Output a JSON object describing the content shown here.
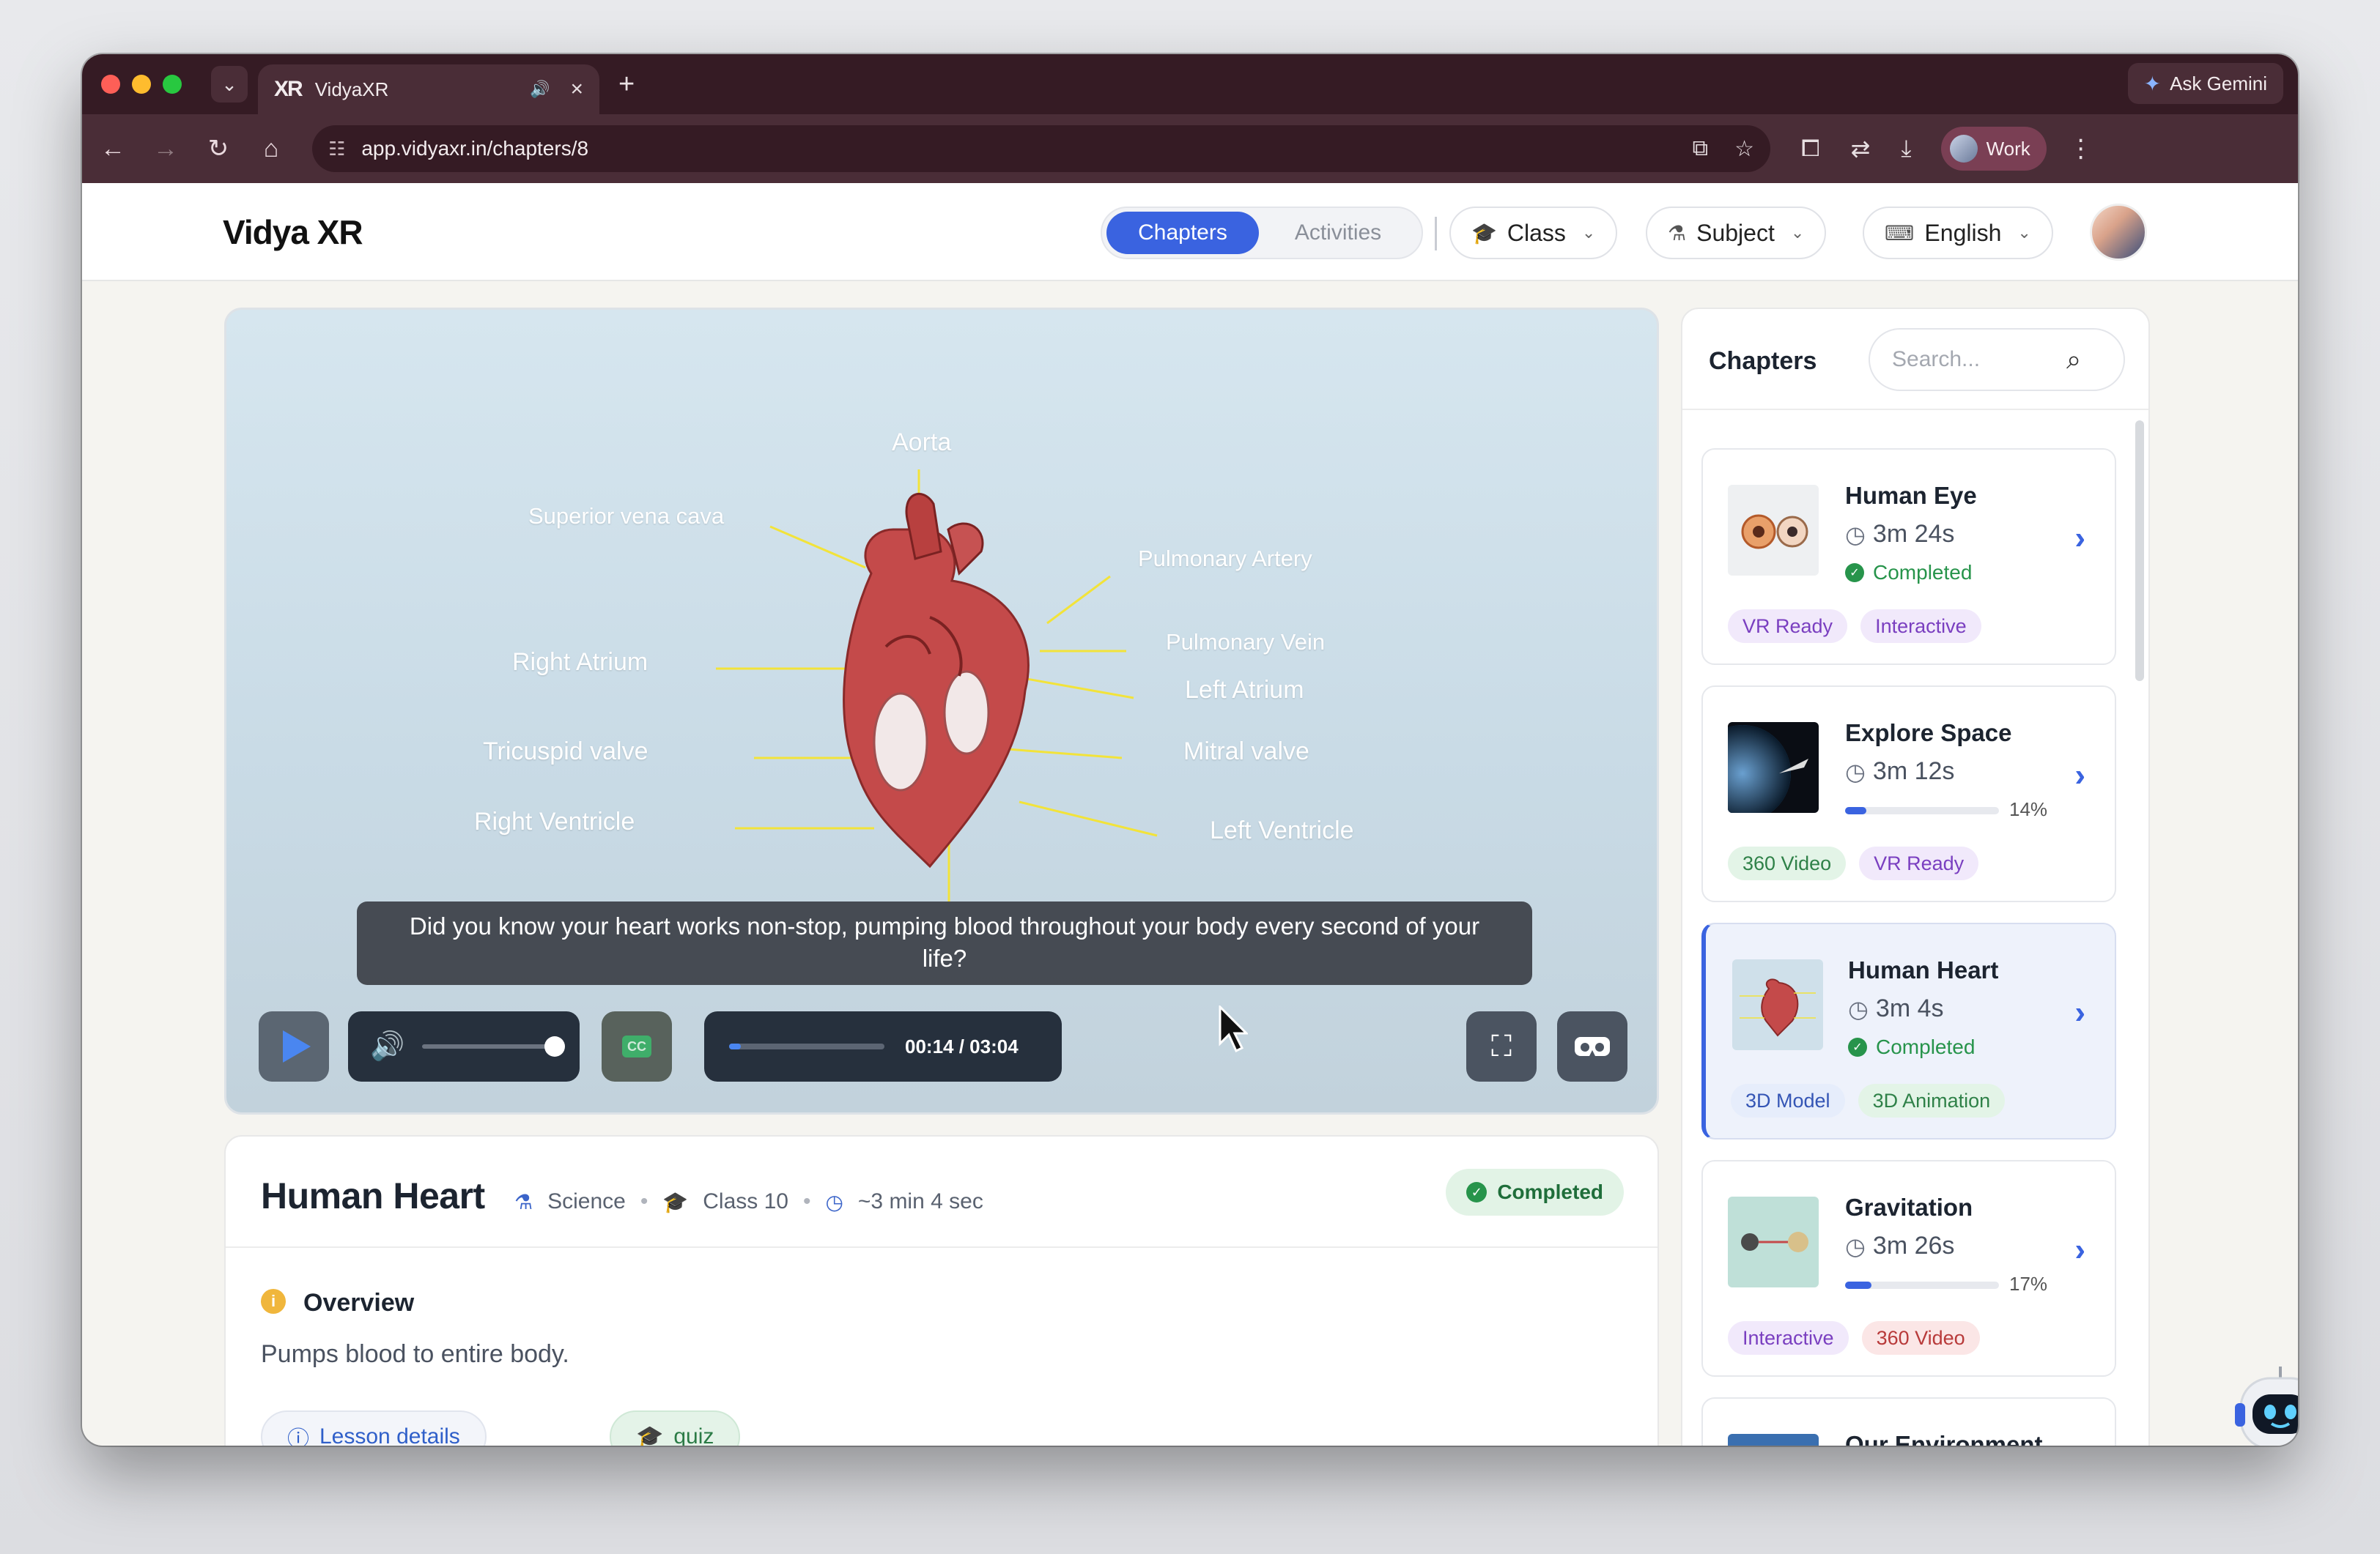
{
  "browser": {
    "tab_title": "VidyaXR",
    "url": "app.vidyaxr.in/chapters/8",
    "gemini_label": "Ask Gemini",
    "profile_label": "Work"
  },
  "header": {
    "logo_text": "Vidya XR",
    "tabs": [
      {
        "label": "Chapters",
        "active": true
      },
      {
        "label": "Activities",
        "active": false
      }
    ],
    "class_label": "Class",
    "subject_label": "Subject",
    "language_label": "English"
  },
  "video": {
    "labels": {
      "aorta": "Aorta",
      "svc": "Superior vena cava",
      "pulm_artery": "Pulmonary Artery",
      "pulm_vein": "Pulmonary Vein",
      "right_atrium": "Right Atrium",
      "left_atrium": "Left Atrium",
      "tricuspid": "Tricuspid valve",
      "mitral": "Mitral valve",
      "right_ventricle": "Right Ventricle",
      "left_ventricle": "Left Ventricle"
    },
    "caption": "Did you know your heart works non-stop, pumping blood throughout your body every second of your life?",
    "cc_label": "CC",
    "time": "00:14 / 03:04",
    "progress": 0.076,
    "volume": 1.0
  },
  "lesson": {
    "title": "Human Heart",
    "subject": "Science",
    "class": "Class 10",
    "duration": "~3 min 4 sec",
    "status": "Completed",
    "overview_title": "Overview",
    "overview_text": "Pumps blood to entire body.",
    "tab_lesson": "Lesson details",
    "tab_quiz": "quiz"
  },
  "sidebar": {
    "title": "Chapters",
    "search_placeholder": "Search...",
    "chapters": [
      {
        "title": "Human Eye",
        "duration": "3m 24s",
        "status": "Completed",
        "progress": null,
        "tags": [
          "VR Ready",
          "Interactive"
        ],
        "active": false
      },
      {
        "title": "Explore Space",
        "duration": "3m 12s",
        "status": "",
        "progress": "14%",
        "tags": [
          "360 Video",
          "VR Ready"
        ],
        "active": false
      },
      {
        "title": "Human Heart",
        "duration": "3m 4s",
        "status": "Completed",
        "progress": null,
        "tags": [
          "3D Model",
          "3D Animation"
        ],
        "active": true
      },
      {
        "title": "Gravitation",
        "duration": "3m 26s",
        "status": "",
        "progress": "17%",
        "tags": [
          "Interactive",
          "360 Video"
        ],
        "active": false
      },
      {
        "title": "Our Environment",
        "duration": "",
        "status": "",
        "progress": null,
        "tags": [],
        "active": false
      }
    ]
  },
  "colors": {
    "accent": "#3a63e0",
    "success": "#27944b",
    "chrome_dark": "#351b24",
    "chrome_mid": "#4a2d37"
  }
}
